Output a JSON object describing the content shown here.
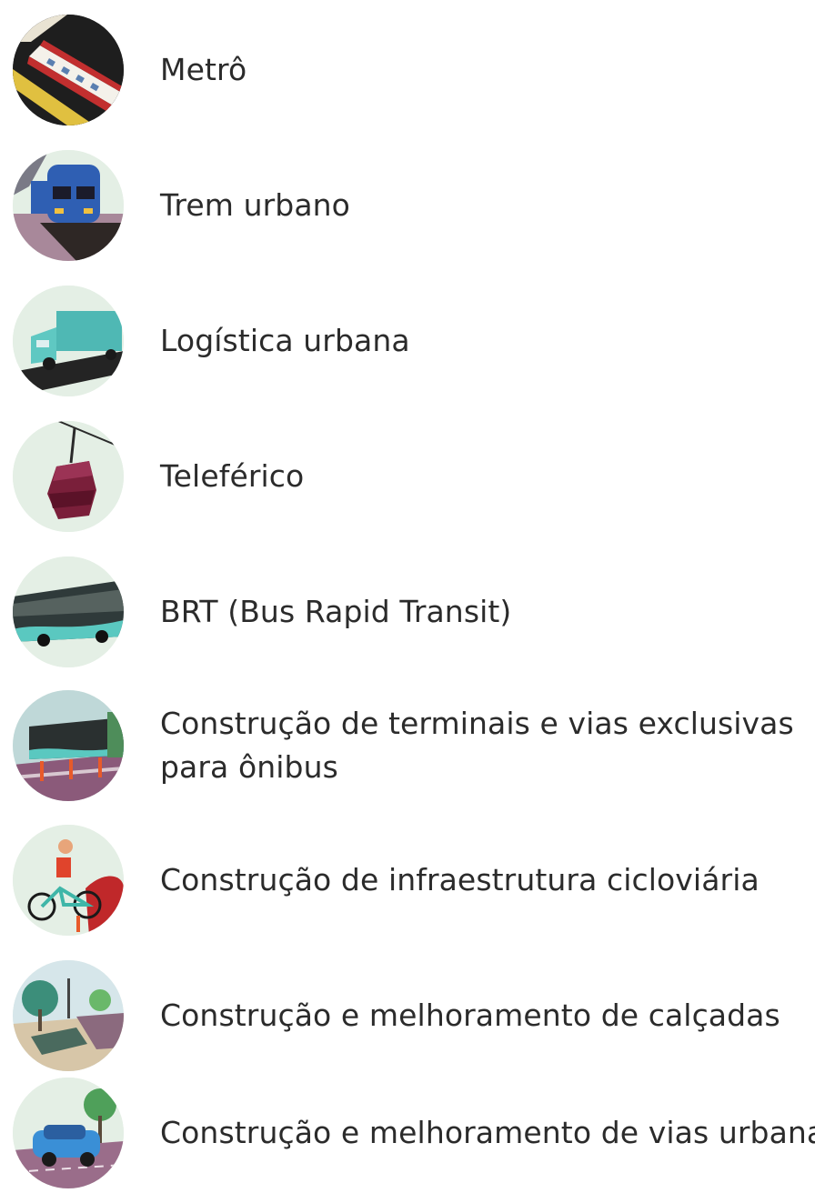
{
  "items": [
    {
      "label": "Metrô",
      "icon": "subway-icon"
    },
    {
      "label": "Trem urbano",
      "icon": "train-icon"
    },
    {
      "label": "Logística urbana",
      "icon": "delivery-truck-icon"
    },
    {
      "label": "Teleférico",
      "icon": "cable-car-icon"
    },
    {
      "label": "BRT (Bus Rapid Transit)",
      "icon": "brt-bus-icon"
    },
    {
      "label": "Construção de terminais e vias exclusivas",
      "label2": "para ônibus",
      "icon": "bus-terminal-icon"
    },
    {
      "label": "Construção de infraestrutura cicloviária",
      "icon": "cyclist-icon"
    },
    {
      "label": "Construção e melhoramento de calçadas",
      "icon": "sidewalk-icon"
    },
    {
      "label": "Construção e melhoramento de vias urbanas",
      "icon": "urban-road-icon"
    }
  ],
  "colors": {
    "icon_background": "#e4efe5",
    "text": "#2b2b2b"
  }
}
